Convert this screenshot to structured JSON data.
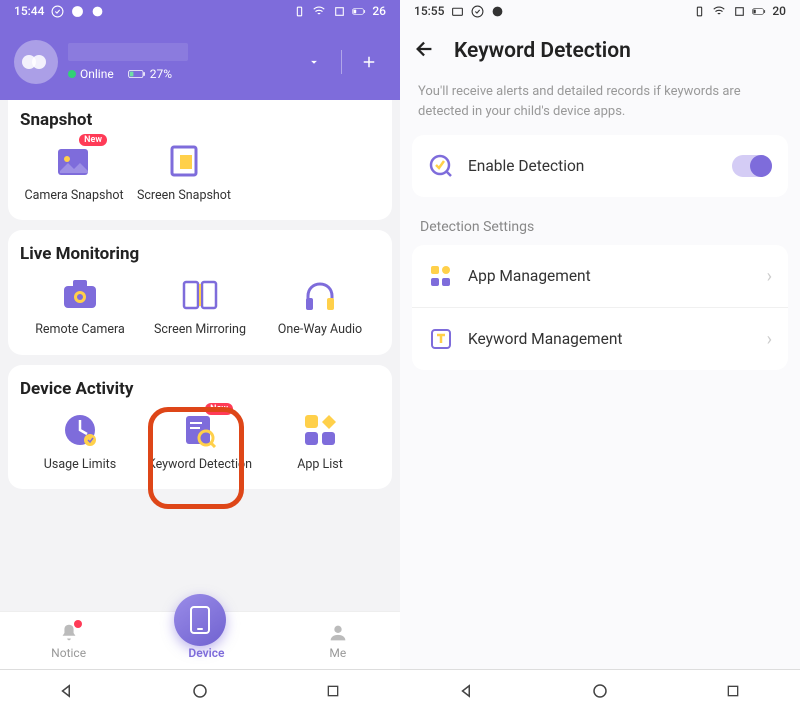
{
  "left": {
    "status": {
      "time": "15:44",
      "battery": "26"
    },
    "header": {
      "online": "Online",
      "batteryPct": "27%"
    },
    "sections": {
      "snapshot": {
        "title": "Snapshot",
        "items": [
          "Camera Snapshot",
          "Screen Snapshot"
        ]
      },
      "live": {
        "title": "Live Monitoring",
        "items": [
          "Remote Camera",
          "Screen Mirroring",
          "One-Way Audio"
        ]
      },
      "activity": {
        "title": "Device Activity",
        "items": [
          "Usage Limits",
          "Keyword Detection",
          "App List"
        ]
      }
    },
    "tabs": {
      "notice": "Notice",
      "device": "Device",
      "me": "Me"
    }
  },
  "right": {
    "status": {
      "time": "15:55",
      "battery": "20"
    },
    "title": "Keyword Detection",
    "desc": "You'll receive alerts and detailed records if keywords are detected in your child's device apps.",
    "enable": "Enable Detection",
    "sectionTitle": "Detection Settings",
    "rows": {
      "app": "App Management",
      "keyword": "Keyword Management"
    }
  }
}
